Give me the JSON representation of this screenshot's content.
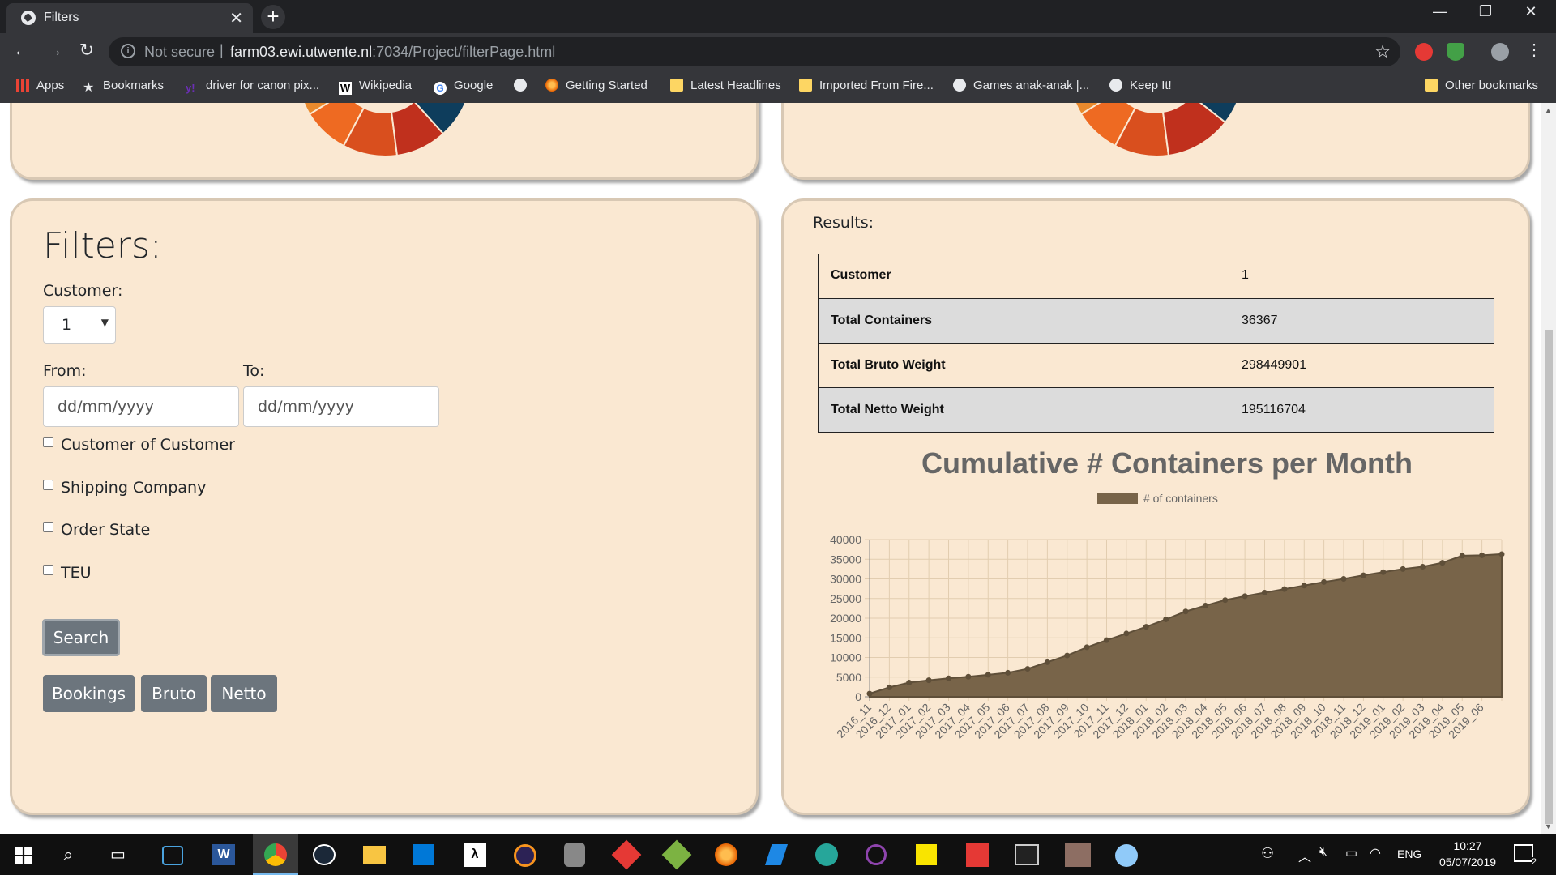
{
  "browser": {
    "tab_title": "Filters",
    "security_label": "Not secure",
    "url_host": "farm03.ewi.utwente.nl",
    "url_path": ":7034/Project/filterPage.html",
    "bookmarks": [
      {
        "label": "Apps",
        "icon": "apps-grid-icon"
      },
      {
        "label": "Bookmarks",
        "icon": "star-icon"
      },
      {
        "label": "driver for canon pix...",
        "icon": "yahoo-icon"
      },
      {
        "label": "Wikipedia",
        "icon": "wikipedia-icon"
      },
      {
        "label": "Google",
        "icon": "google-icon"
      },
      {
        "label": "",
        "icon": "globe-icon"
      },
      {
        "label": "Getting Started",
        "icon": "firefox-icon"
      },
      {
        "label": "Latest Headlines",
        "icon": "folder-icon"
      },
      {
        "label": "Imported From Fire...",
        "icon": "folder-icon"
      },
      {
        "label": "Games anak-anak |...",
        "icon": "globe-icon"
      },
      {
        "label": "Keep It!",
        "icon": "globe-icon"
      },
      {
        "label": "Other bookmarks",
        "icon": "folder-icon"
      }
    ]
  },
  "filters": {
    "title": "Filters:",
    "customer_label": "Customer:",
    "customer_value": "1",
    "from_label": "From:",
    "to_label": "To:",
    "from_placeholder": "dd/mm/yyyy",
    "to_placeholder": "dd/mm/yyyy",
    "checkboxes": [
      "Customer of Customer",
      "Shipping Company",
      "Order State",
      "TEU"
    ],
    "search_button": "Search",
    "buttons": [
      "Bookings",
      "Bruto",
      "Netto"
    ]
  },
  "results": {
    "title": "Results:",
    "rows": [
      {
        "key": "Customer",
        "value": "1"
      },
      {
        "key": "Total Containers",
        "value": "36367"
      },
      {
        "key": "Total Bruto Weight",
        "value": "298449901"
      },
      {
        "key": "Total Netto Weight",
        "value": "195116704"
      }
    ]
  },
  "colors": {
    "card_bg": "#fae8d2",
    "area_fill": "#786449",
    "donut": [
      "#e98a2d",
      "#ee6a22",
      "#d94f1e",
      "#c0301d",
      "#0e3d5c"
    ]
  },
  "chart_data": {
    "type": "area",
    "title": "Cumulative # Containers per Month",
    "series": [
      {
        "name": "# of containers",
        "values": [
          800,
          2400,
          3600,
          4200,
          4700,
          5100,
          5600,
          6100,
          7100,
          8800,
          10500,
          12600,
          14400,
          16100,
          17800,
          19700,
          21700,
          23200,
          24600,
          25600,
          26500,
          27400,
          28300,
          29200,
          30000,
          30900,
          31700,
          32500,
          33100,
          34100,
          35900,
          36000,
          36300
        ]
      }
    ],
    "categories": [
      "2016_11",
      "2016_12",
      "2017_01",
      "2017_02",
      "2017_03",
      "2017_04",
      "2017_05",
      "2017_06",
      "2017_07",
      "2017_08",
      "2017_09",
      "2017_10",
      "2017_11",
      "2017_12",
      "2018_01",
      "2018_02",
      "2018_03",
      "2018_04",
      "2018_05",
      "2018_06",
      "2018_07",
      "2018_08",
      "2018_09",
      "2018_10",
      "2018_11",
      "2018_12",
      "2019_01",
      "2019_02",
      "2019_03",
      "2019_04",
      "2019_05",
      "2019_06"
    ],
    "ylim": [
      0,
      40000
    ],
    "yticks": [
      0,
      5000,
      10000,
      15000,
      20000,
      25000,
      30000,
      35000,
      40000
    ],
    "legend_position": "top",
    "grid": true
  },
  "taskbar": {
    "lang": "ENG",
    "time": "10:27",
    "date": "05/07/2019",
    "notifications": "2"
  }
}
